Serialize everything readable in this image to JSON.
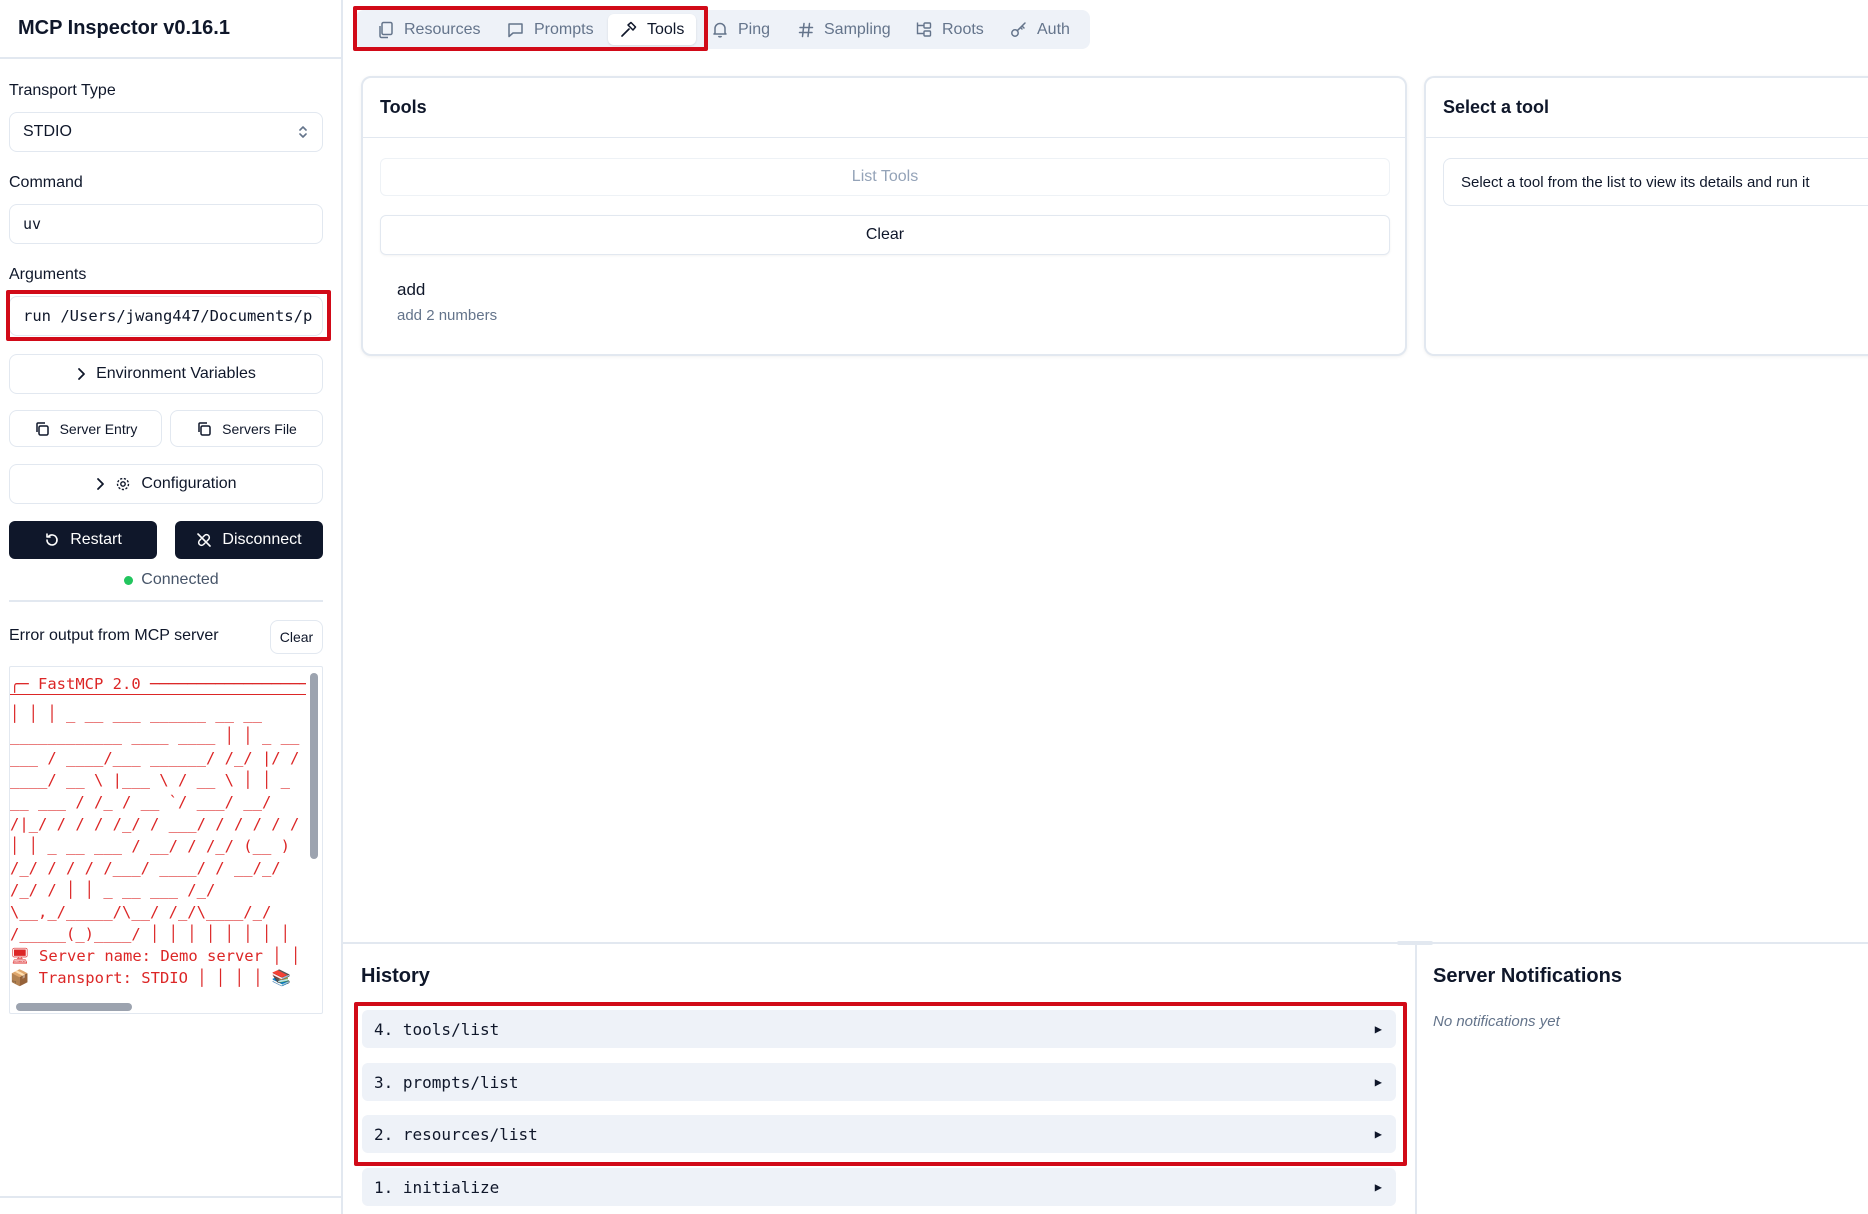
{
  "app": {
    "title": "MCP Inspector v0.16.1"
  },
  "sidebar": {
    "transport_label": "Transport Type",
    "transport_value": "STDIO",
    "command_label": "Command",
    "command_value": "uv",
    "arguments_label": "Arguments",
    "arguments_value": "run /Users/jwang447/Documents/p",
    "env_button": "Environment Variables",
    "server_entry_button": "Server Entry",
    "servers_file_button": "Servers File",
    "configuration_button": "Configuration",
    "restart_button": "Restart",
    "disconnect_button": "Disconnect",
    "status_text": "Connected",
    "status_color": "#22c55e",
    "error_title": "Error output from MCP server",
    "error_clear": "Clear",
    "error_lines": [
      "╭─ FastMCP 2.0 ──────────────────",
      "│ │ │ _ __ ___ ______ __ __",
      "____________ ____ ____ │ │ _ __",
      "___ / ____/___ ______/ /_/ |/ /",
      "____/ __ \\ |___ \\ / __ \\ │ │ _",
      "__ ___ / /_ / __ `/ ___/ __/",
      "/|_/ / / / /_/ / ___/ / / / / /",
      "│ │ _ __ ___ / __/ / /_/ (__ )",
      "/_/ / / / /___/ ____/ / __/_/",
      "/_/ / │ │ _ __ ___ /_/",
      "\\__,_/_____/\\__/ /_/\\____/_/",
      "/_____(_)____/ │ │ │ │ │ │ │ │",
      "🖥 Server name: Demo server │ │",
      "📦 Transport: STDIO │ │ │ │ 📚"
    ]
  },
  "tabs": [
    {
      "label": "Resources",
      "icon": "files-icon"
    },
    {
      "label": "Prompts",
      "icon": "message-square-icon"
    },
    {
      "label": "Tools",
      "icon": "hammer-icon"
    },
    {
      "label": "Ping",
      "icon": "bell-icon"
    },
    {
      "label": "Sampling",
      "icon": "hash-icon"
    },
    {
      "label": "Roots",
      "icon": "folder-tree-icon"
    },
    {
      "label": "Auth",
      "icon": "key-icon"
    }
  ],
  "tools_panel": {
    "title": "Tools",
    "list_button": "List Tools",
    "clear_button": "Clear",
    "items": [
      {
        "name": "add",
        "description": "add 2 numbers"
      }
    ]
  },
  "tool_detail": {
    "title": "Select a tool",
    "hint": "Select a tool from the list to view its details and run it"
  },
  "history": {
    "title": "History",
    "items": [
      {
        "label": "4. tools/list"
      },
      {
        "label": "3. prompts/list"
      },
      {
        "label": "2. resources/list"
      },
      {
        "label": "1. initialize"
      }
    ]
  },
  "notifications": {
    "title": "Server Notifications",
    "empty_text": "No notifications yet"
  },
  "colors": {
    "highlight": "#d10a18",
    "error_text": "#dc2626",
    "dark_button": "#0f172a"
  }
}
